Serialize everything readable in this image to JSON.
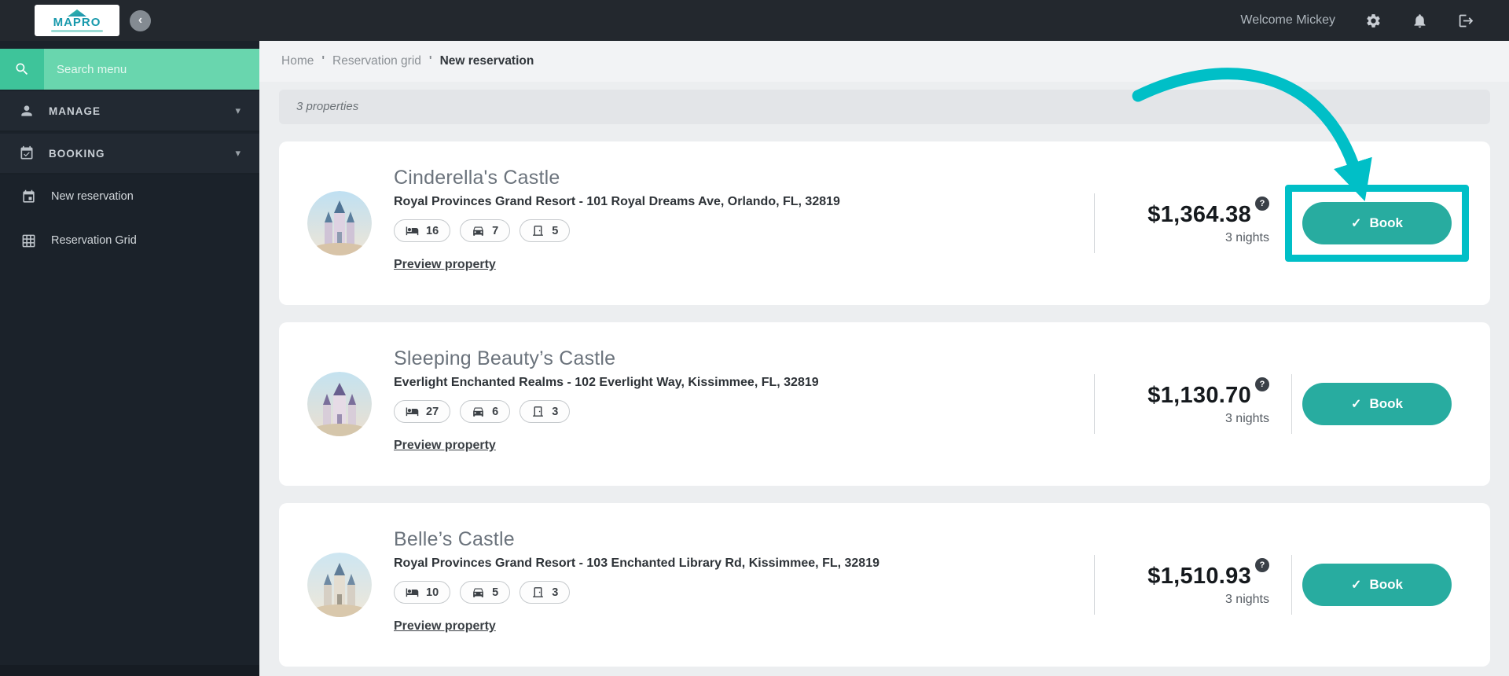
{
  "topbar": {
    "logo": "MAPRO",
    "welcome": "Welcome Mickey"
  },
  "glyphs": {
    "collapse": "‹",
    "caret_down": "▾",
    "separator": "'",
    "check": "✓",
    "help": "?"
  },
  "sidebar": {
    "search_placeholder": "Search menu",
    "manage_label": "MANAGE",
    "booking_label": "BOOKING",
    "new_reservation_label": "New reservation",
    "reservation_grid_label": "Reservation Grid"
  },
  "breadcrumb": {
    "home": "Home",
    "level1": "Reservation grid",
    "current": "New reservation"
  },
  "results_bar": {
    "label": "3 properties"
  },
  "card_common": {
    "preview_label": "Preview property",
    "book_label": "Book"
  },
  "properties": [
    {
      "name": "Cinderella's Castle",
      "address": "Royal Provinces Grand Resort - 101 Royal Dreams Ave, Orlando, FL, 32819",
      "badges": {
        "bed": "16",
        "car": "7",
        "door": "5"
      },
      "price": "$1,364.38",
      "nights": "3 nights"
    },
    {
      "name": "Sleeping Beauty’s Castle",
      "address": "Everlight Enchanted Realms - 102 Everlight Way, Kissimmee, FL, 32819",
      "badges": {
        "bed": "27",
        "car": "6",
        "door": "3"
      },
      "price": "$1,130.70",
      "nights": "3 nights"
    },
    {
      "name": "Belle’s Castle",
      "address": "Royal Provinces Grand Resort - 103 Enchanted Library Rd, Kissimmee, FL, 32819",
      "badges": {
        "bed": "10",
        "car": "5",
        "door": "3"
      },
      "price": "$1,510.93",
      "nights": "3 nights"
    }
  ],
  "colors": {
    "accent_teal": "#28aca0",
    "annotation_teal": "#00bfc7",
    "search_mint": "#69d6ae",
    "topbar_dark": "#23282e",
    "sidebar_dark": "#1b222a"
  }
}
